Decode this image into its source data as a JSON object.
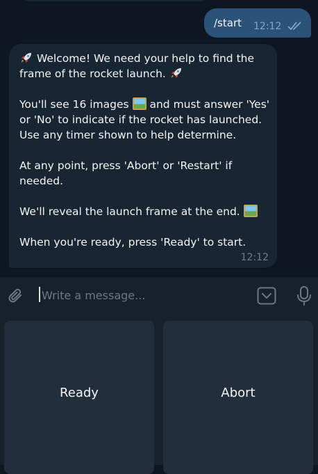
{
  "outgoing": {
    "text": "/start",
    "time": "12:12",
    "status_icon": "double-check-icon"
  },
  "incoming": {
    "lines": {
      "l1": "Welcome! We need your help to find the frame of the rocket launch.",
      "l2a": "You'll see 16 images",
      "l2b": "and must answer 'Yes' or 'No' to indicate if the rocket has launched. Use any timer shown to help determine.",
      "l3": "At any point, press 'Abort' or 'Restart' if needed.",
      "l4": "We'll reveal the launch frame at the end.",
      "l5": "When you're ready, press 'Ready' to start."
    },
    "time": "12:12"
  },
  "composer": {
    "placeholder": "Write a message..."
  },
  "keyboard": {
    "ready_label": "Ready",
    "abort_label": "Abort"
  },
  "colors": {
    "background": "#0e1621",
    "incoming_bubble": "#182533",
    "outgoing_bubble": "#2b5278",
    "panel": "#17212b",
    "button": "#232e3c"
  }
}
